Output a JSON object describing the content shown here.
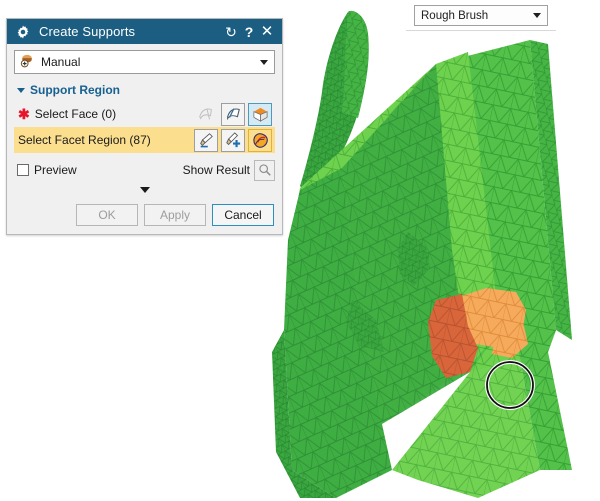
{
  "viewport": {
    "name": "3d-model-viewport",
    "model_color_lit": "#6fd14f",
    "model_color_mid": "#4bbf46",
    "model_color_dark": "#3aa83f",
    "selection_color_lit": "#f5ab5a",
    "selection_color_dark": "#d9663b",
    "brush_cursor": "circle"
  },
  "brush_toolbar": {
    "mode_label": "Rough Brush",
    "caret": "chevron-down-icon"
  },
  "dialog": {
    "title": "Create Supports",
    "title_icon": "gear-icon",
    "buttons": {
      "reset": "↻",
      "help": "?",
      "close": "✕"
    },
    "mode": {
      "icon": "manual-support-icon",
      "value": "Manual",
      "caret": "chevron-down-icon"
    },
    "group": {
      "label": "Support Region",
      "expander": "triangle-down-icon"
    },
    "rows": [
      {
        "label": "Select Face (0)",
        "required": true,
        "highlighted": false,
        "tools": [
          {
            "name": "select-face-tool-icon",
            "state": "disabled"
          },
          {
            "name": "select-surface-tool-icon",
            "state": "normal"
          },
          {
            "name": "select-body-tool-icon",
            "state": "active"
          }
        ]
      },
      {
        "label": "Select Facet Region (87)",
        "required": false,
        "highlighted": true,
        "tools": [
          {
            "name": "brush-remove-icon",
            "state": "normal"
          },
          {
            "name": "brush-add-icon",
            "state": "normal"
          },
          {
            "name": "facet-region-icon",
            "state": "active-amber"
          }
        ]
      }
    ],
    "preview": {
      "checkbox_label": "Preview",
      "checked": false,
      "show_result_label": "Show Result",
      "show_result_icon": "magnifier-icon"
    },
    "expander_icon": "chevron-down-icon",
    "footer": {
      "ok_label": "OK",
      "ok_enabled": false,
      "apply_label": "Apply",
      "apply_enabled": false,
      "cancel_label": "Cancel",
      "cancel_enabled": true
    }
  }
}
